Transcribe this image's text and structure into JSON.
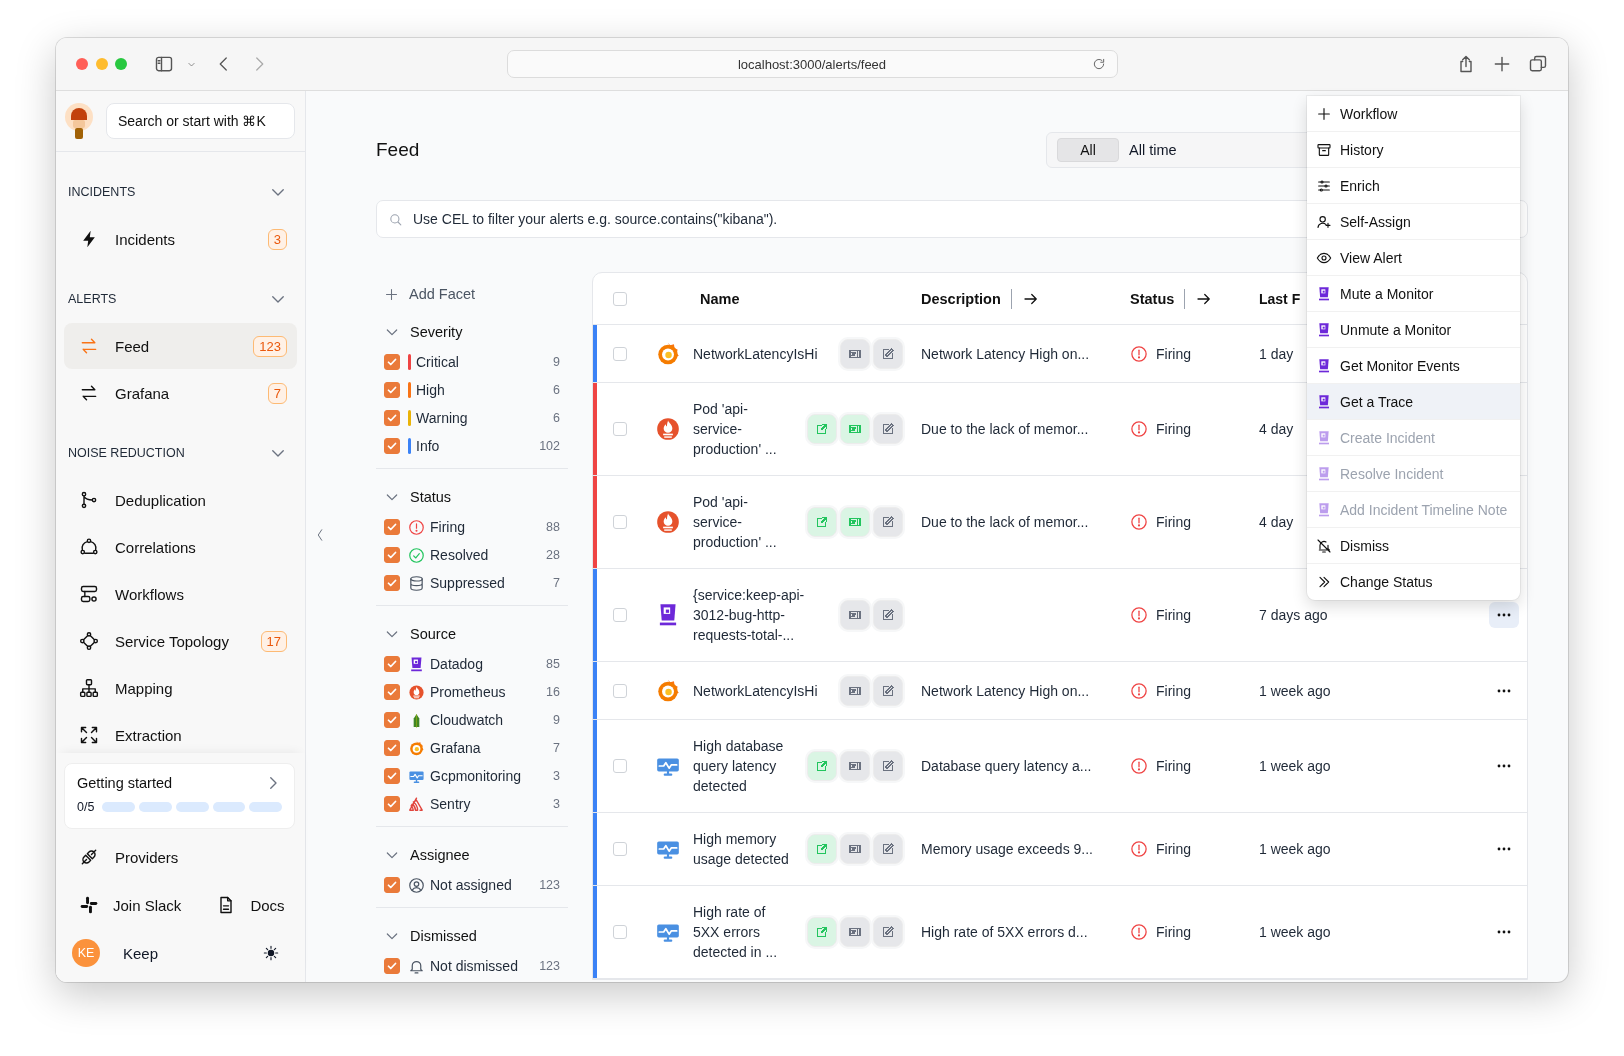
{
  "browser": {
    "url": "localhost:3000/alerts/feed"
  },
  "sidebar": {
    "search": {
      "label": "Search or start with ⌘K"
    },
    "sections": [
      {
        "title": "INCIDENTS",
        "expanded": true,
        "items": [
          {
            "label": "Incidents",
            "kind": "bolt",
            "count": "3",
            "selected": false
          }
        ]
      },
      {
        "title": "ALERTS",
        "expanded": true,
        "items": [
          {
            "label": "Feed",
            "kind": "arrows",
            "count": "123",
            "selected": true
          },
          {
            "label": "Grafana",
            "kind": "arrows",
            "count": "7",
            "selected": false
          }
        ]
      },
      {
        "title": "NOISE REDUCTION",
        "expanded": true,
        "items": [
          {
            "label": "Deduplication",
            "kind": "branch",
            "selected": false
          },
          {
            "label": "Correlations",
            "kind": "nodes",
            "selected": false
          },
          {
            "label": "Workflows",
            "kind": "workflow",
            "selected": false
          },
          {
            "label": "Service Topology",
            "kind": "topology",
            "count": "17",
            "selected": false
          },
          {
            "label": "Mapping",
            "kind": "sitemap",
            "selected": false
          },
          {
            "label": "Extraction",
            "kind": "extract",
            "selected": false
          }
        ]
      }
    ],
    "getting_started": {
      "title": "Getting started",
      "progress": "0/5",
      "steps": [
        {
          "done": false
        },
        {
          "done": false
        },
        {
          "done": false
        },
        {
          "done": false
        },
        {
          "done": false
        }
      ]
    },
    "links": [
      {
        "label": "Providers",
        "kind": "plug"
      }
    ],
    "footer_links": [
      {
        "label": "Join Slack",
        "kind": "slack"
      },
      {
        "label": "Docs",
        "kind": "doc"
      }
    ],
    "user": {
      "initials": "KE",
      "name": "Keep"
    }
  },
  "feed": {
    "title": "Feed",
    "time_filter": {
      "options": [
        {
          "label": "All",
          "selected": true
        }
      ],
      "range": "All time"
    },
    "search": {
      "placeholder": "Use CEL to filter your alerts e.g. source.contains(\"kibana\")."
    }
  },
  "facets": {
    "add_label": "Add Facet",
    "groups": [
      {
        "title": "Severity",
        "expanded": true,
        "options": [
          {
            "label": "Critical",
            "kind": "severity",
            "color": "#ef4444",
            "count": "9",
            "checked": true
          },
          {
            "label": "High",
            "kind": "severity",
            "color": "#f97316",
            "count": "6",
            "checked": true
          },
          {
            "label": "Warning",
            "kind": "severity",
            "color": "#eab308",
            "count": "6",
            "checked": true
          },
          {
            "label": "Info",
            "kind": "severity",
            "color": "#3b82f6",
            "count": "102",
            "checked": true
          }
        ]
      },
      {
        "title": "Status",
        "expanded": true,
        "options": [
          {
            "label": "Firing",
            "kind": "firing",
            "count": "88",
            "checked": true
          },
          {
            "label": "Resolved",
            "kind": "resolved",
            "count": "28",
            "checked": true
          },
          {
            "label": "Suppressed",
            "kind": "suppressed",
            "count": "7",
            "checked": true
          }
        ]
      },
      {
        "title": "Source",
        "expanded": true,
        "options": [
          {
            "label": "Datadog",
            "kind": "datadog",
            "count": "85",
            "checked": true
          },
          {
            "label": "Prometheus",
            "kind": "prometheus",
            "count": "16",
            "checked": true
          },
          {
            "label": "Cloudwatch",
            "kind": "cloudwatch",
            "count": "9",
            "checked": true
          },
          {
            "label": "Grafana",
            "kind": "grafana",
            "count": "7",
            "checked": true
          },
          {
            "label": "Gcpmonitoring",
            "kind": "gcp",
            "count": "3",
            "checked": true
          },
          {
            "label": "Sentry",
            "kind": "sentry",
            "count": "3",
            "checked": true
          }
        ]
      },
      {
        "title": "Assignee",
        "expanded": true,
        "options": [
          {
            "label": "Not assigned",
            "kind": "user",
            "count": "123",
            "checked": true
          }
        ]
      },
      {
        "title": "Dismissed",
        "expanded": true,
        "options": [
          {
            "label": "Not dismissed",
            "kind": "bell",
            "count": "123",
            "checked": true
          }
        ]
      }
    ]
  },
  "table": {
    "all_checked": false,
    "columns": [
      {
        "label": "Name",
        "arrow": false
      },
      {
        "label": "Description",
        "arrow": true
      },
      {
        "label": "Status",
        "arrow": true
      },
      {
        "label": "Last F",
        "arrow": false
      }
    ],
    "rows": [
      {
        "checked": false,
        "color": "#3b82f6",
        "source": {
          "kind": "grafana"
        },
        "name": "NetworkLatencyIsHi",
        "actions": [
          {
            "kind": "ticket",
            "color": "#6b7280"
          },
          {
            "kind": "edit",
            "color": "#6b7280"
          }
        ],
        "description": "Network Latency High on...",
        "status": {
          "label": "Firing",
          "kind": "firing"
        },
        "last_received": "1 day"
      },
      {
        "checked": false,
        "color": "#ef4444",
        "source": {
          "kind": "prometheus"
        },
        "name": "Pod 'api-service-production' ...",
        "actions": [
          {
            "kind": "link",
            "color": "#22c55e"
          },
          {
            "kind": "ticket",
            "color": "#22c55e"
          },
          {
            "kind": "edit",
            "color": "#6b7280"
          }
        ],
        "description": "Due to the lack of memor...",
        "status": {
          "label": "Firing",
          "kind": "firing"
        },
        "last_received": "4 day"
      },
      {
        "checked": false,
        "color": "#ef4444",
        "source": {
          "kind": "prometheus"
        },
        "name": "Pod 'api-service-production' ...",
        "actions": [
          {
            "kind": "link",
            "color": "#22c55e"
          },
          {
            "kind": "ticket",
            "color": "#22c55e"
          },
          {
            "kind": "edit",
            "color": "#6b7280"
          }
        ],
        "description": "Due to the lack of memor...",
        "status": {
          "label": "Firing",
          "kind": "firing"
        },
        "last_received": "4 day"
      },
      {
        "checked": false,
        "color": "#3b82f6",
        "source": {
          "kind": "datadog"
        },
        "name": "{service:keep-api-3012-bug-http-requests-total-...",
        "actions": [
          {
            "kind": "ticket",
            "color": "#6b7280"
          },
          {
            "kind": "edit",
            "color": "#6b7280"
          }
        ],
        "status": {
          "label": "Firing",
          "kind": "firing"
        },
        "last_received": "7 days ago",
        "more_active": true
      },
      {
        "checked": false,
        "color": "#3b82f6",
        "source": {
          "kind": "grafana"
        },
        "name": "NetworkLatencyIsHi",
        "actions": [
          {
            "kind": "ticket",
            "color": "#6b7280"
          },
          {
            "kind": "edit",
            "color": "#6b7280"
          }
        ],
        "description": "Network Latency High on...",
        "status": {
          "label": "Firing",
          "kind": "firing"
        },
        "last_received": "1 week ago",
        "more_active": false
      },
      {
        "checked": false,
        "color": "#3b82f6",
        "source": {
          "kind": "gcp"
        },
        "name": "High database query latency detected",
        "actions": [
          {
            "kind": "link",
            "color": "#22c55e"
          },
          {
            "kind": "ticket",
            "color": "#6b7280"
          },
          {
            "kind": "edit",
            "color": "#6b7280"
          }
        ],
        "description": "Database query latency a...",
        "status": {
          "label": "Firing",
          "kind": "firing"
        },
        "last_received": "1 week ago",
        "more_active": false
      },
      {
        "checked": false,
        "color": "#3b82f6",
        "source": {
          "kind": "gcp"
        },
        "name": "High memory usage detected",
        "actions": [
          {
            "kind": "link",
            "color": "#22c55e"
          },
          {
            "kind": "ticket",
            "color": "#6b7280"
          },
          {
            "kind": "edit",
            "color": "#6b7280"
          }
        ],
        "description": "Memory usage exceeds 9...",
        "status": {
          "label": "Firing",
          "kind": "firing"
        },
        "last_received": "1 week ago",
        "more_active": false
      },
      {
        "checked": false,
        "color": "#3b82f6",
        "source": {
          "kind": "gcp"
        },
        "name": "High rate of 5XX errors detected in ...",
        "actions": [
          {
            "kind": "link",
            "color": "#22c55e"
          },
          {
            "kind": "ticket",
            "color": "#6b7280"
          },
          {
            "kind": "edit",
            "color": "#6b7280"
          }
        ],
        "description": "High rate of 5XX errors d...",
        "status": {
          "label": "Firing",
          "kind": "firing"
        },
        "last_received": "1 week ago",
        "more_active": false
      }
    ]
  },
  "menu": {
    "items": [
      {
        "label": "Workflow",
        "kind": "plus",
        "disabled": false,
        "highlighted": false
      },
      {
        "label": "History",
        "kind": "archive",
        "disabled": false,
        "highlighted": false
      },
      {
        "label": "Enrich",
        "kind": "sliders",
        "disabled": false,
        "highlighted": false
      },
      {
        "label": "Self-Assign",
        "kind": "user-plus",
        "disabled": false,
        "highlighted": false
      },
      {
        "label": "View Alert",
        "kind": "eye",
        "disabled": false,
        "highlighted": false
      },
      {
        "label": "Mute a Monitor",
        "kind": "datadog",
        "disabled": false,
        "highlighted": false
      },
      {
        "label": "Unmute a Monitor",
        "kind": "datadog",
        "disabled": false,
        "highlighted": false
      },
      {
        "label": "Get Monitor Events",
        "kind": "datadog",
        "disabled": false,
        "highlighted": false
      },
      {
        "label": "Get a Trace",
        "kind": "datadog",
        "disabled": false,
        "highlighted": true
      },
      {
        "label": "Create Incident",
        "kind": "datadog",
        "disabled": true,
        "highlighted": false
      },
      {
        "label": "Resolve Incident",
        "kind": "datadog",
        "disabled": true,
        "highlighted": false
      },
      {
        "label": "Add Incident Timeline Note",
        "kind": "datadog",
        "disabled": true,
        "highlighted": false
      },
      {
        "label": "Dismiss",
        "kind": "bell-off",
        "disabled": false,
        "highlighted": false
      },
      {
        "label": "Change Status",
        "kind": "chevrons",
        "disabled": false,
        "highlighted": false
      }
    ]
  }
}
